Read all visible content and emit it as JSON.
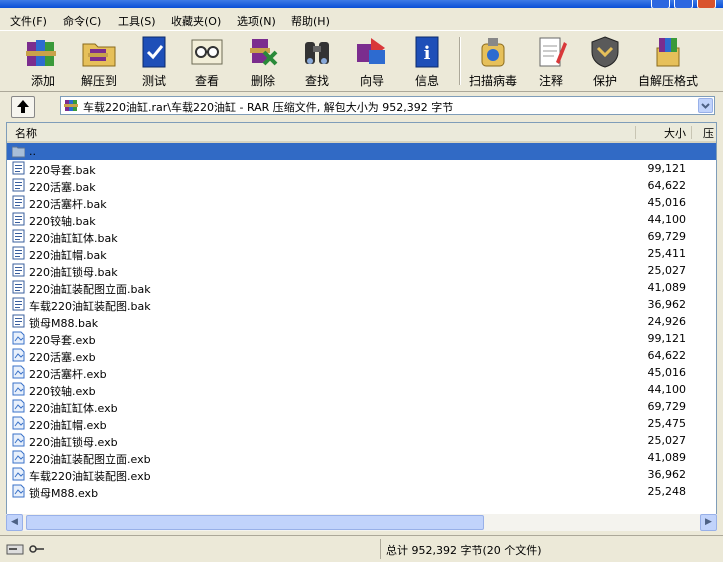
{
  "menu": [
    "文件(F)",
    "命令(C)",
    "工具(S)",
    "收藏夹(O)",
    "选项(N)",
    "帮助(H)"
  ],
  "toolbar": [
    {
      "label": "添加",
      "icon": "books-add-icon"
    },
    {
      "label": "解压到",
      "icon": "folder-extract-icon"
    },
    {
      "label": "测试",
      "icon": "test-book-icon"
    },
    {
      "label": "查看",
      "icon": "glasses-view-icon"
    },
    {
      "label": "删除",
      "icon": "delete-icon"
    },
    {
      "label": "查找",
      "icon": "binoculars-icon"
    },
    {
      "label": "向导",
      "icon": "wizard-icon"
    },
    {
      "label": "信息",
      "icon": "info-icon"
    },
    {
      "label": "扫描病毒",
      "icon": "virus-scan-icon"
    },
    {
      "label": "注释",
      "icon": "comment-icon"
    },
    {
      "label": "保护",
      "icon": "shield-icon"
    },
    {
      "label": "自解压格式",
      "icon": "sfx-icon"
    }
  ],
  "address": {
    "path": "车载220油缸.rar\\车载220油缸 - RAR 压缩文件, 解包大小为 952,392 字节"
  },
  "columns": {
    "name": "名称",
    "size": "大小",
    "rest": "压"
  },
  "files": [
    {
      "name": "..",
      "size": "",
      "type": "folder",
      "selected": true
    },
    {
      "name": "220导套.bak",
      "size": "99,121",
      "type": "bak"
    },
    {
      "name": "220活塞.bak",
      "size": "64,622",
      "type": "bak"
    },
    {
      "name": "220活塞杆.bak",
      "size": "45,016",
      "type": "bak"
    },
    {
      "name": "220铰轴.bak",
      "size": "44,100",
      "type": "bak"
    },
    {
      "name": "220油缸缸体.bak",
      "size": "69,729",
      "type": "bak"
    },
    {
      "name": "220油缸帽.bak",
      "size": "25,411",
      "type": "bak"
    },
    {
      "name": "220油缸锁母.bak",
      "size": "25,027",
      "type": "bak"
    },
    {
      "name": "220油缸装配图立面.bak",
      "size": "41,089",
      "type": "bak"
    },
    {
      "name": "车载220油缸装配图.bak",
      "size": "36,962",
      "type": "bak"
    },
    {
      "name": "锁母M88.bak",
      "size": "24,926",
      "type": "bak"
    },
    {
      "name": "220导套.exb",
      "size": "99,121",
      "type": "exb"
    },
    {
      "name": "220活塞.exb",
      "size": "64,622",
      "type": "exb"
    },
    {
      "name": "220活塞杆.exb",
      "size": "45,016",
      "type": "exb"
    },
    {
      "name": "220铰轴.exb",
      "size": "44,100",
      "type": "exb"
    },
    {
      "name": "220油缸缸体.exb",
      "size": "69,729",
      "type": "exb"
    },
    {
      "name": "220油缸帽.exb",
      "size": "25,475",
      "type": "exb"
    },
    {
      "name": "220油缸锁母.exb",
      "size": "25,027",
      "type": "exb"
    },
    {
      "name": "220油缸装配图立面.exb",
      "size": "41,089",
      "type": "exb"
    },
    {
      "name": "车载220油缸装配图.exb",
      "size": "36,962",
      "type": "exb"
    },
    {
      "name": "锁母M88.exb",
      "size": "25,248",
      "type": "exb"
    }
  ],
  "status": {
    "total": "总计 952,392 字节(20 个文件)"
  },
  "colors": {
    "titlebar": "#0a4fd6",
    "selection": "#316ac5",
    "chrome": "#ece9d8"
  }
}
